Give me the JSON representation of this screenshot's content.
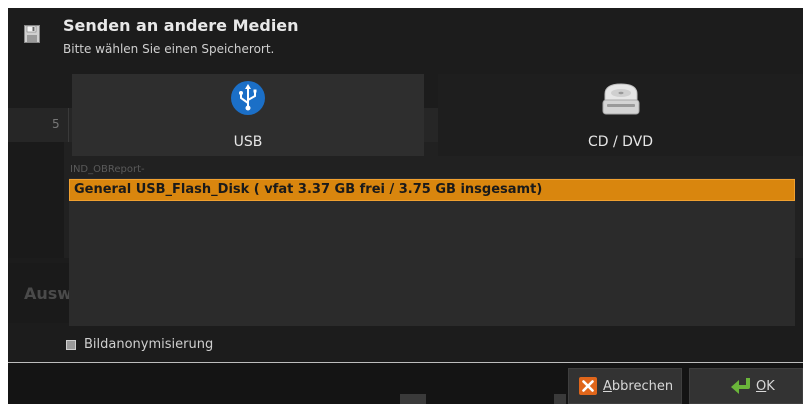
{
  "dialog": {
    "title": "Senden an andere Medien",
    "subtitle": "Bitte wählen Sie einen Speicherort.",
    "header_icon": "floppy-disk-icon"
  },
  "background": {
    "tab_label": "5",
    "partial_text": "Ausw"
  },
  "media": {
    "options": [
      {
        "label": "USB",
        "icon": "usb-icon",
        "selected": true
      },
      {
        "label": "CD / DVD",
        "icon": "optical-drive-icon",
        "selected": false
      }
    ]
  },
  "path_label": "IND_OBReport-",
  "devices": [
    {
      "label": "General USB_Flash_Disk ( vfat 3.37 GB frei / 3.75 GB insgesamt)",
      "selected": true
    }
  ],
  "options": {
    "anonymize_label": "Bildanonymisierung",
    "anonymize_checked": false
  },
  "footer": {
    "cancel_first": "A",
    "cancel_rest": "bbrechen",
    "cancel_icon": "close-x-icon",
    "ok_first": "O",
    "ok_rest": "K",
    "ok_icon": "enter-arrow-icon"
  },
  "colors": {
    "accent": "#d9860e",
    "dialog_bg": "#1c1c1c",
    "usb_blue": "#1b6fc7",
    "cancel_orange": "#e0661b",
    "ok_green": "#6ab53a"
  }
}
